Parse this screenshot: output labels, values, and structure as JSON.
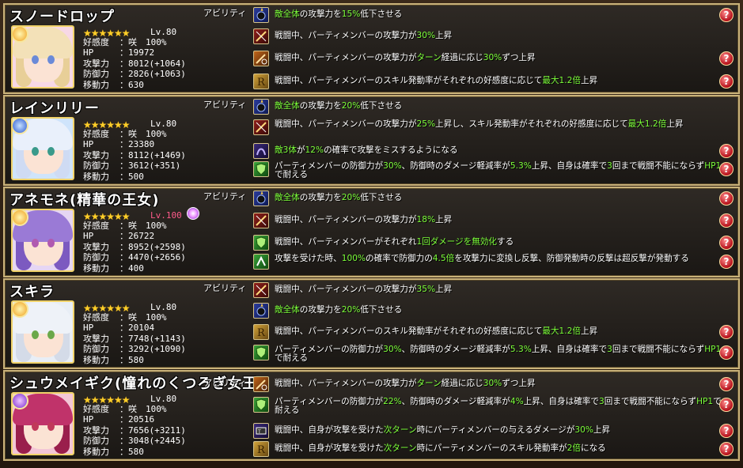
{
  "labels": {
    "ability_tag": "アビリティ",
    "level_prefix": "Lv.",
    "affection": "好感度",
    "hp": "HP",
    "attack": "攻撃力",
    "defense": "防御力",
    "movement": "移動力",
    "help": "?"
  },
  "colors": {
    "panel_border": "#c9b27a",
    "highlight_green": "#7dff3a",
    "help_red": "#b40f1a",
    "level_red": "#ff5a8a",
    "star_gold": "#ffcf2a"
  },
  "characters": [
    {
      "name": "スノードロップ",
      "level": "Lv.80",
      "stars": "★★★★★★",
      "affection": "：咲　100%",
      "hp": "：19972",
      "attack": "：8012(+1064)",
      "defense": "：2826(+1063)",
      "movement": "：630",
      "attribute_icon": "sun-attribute-icon",
      "abilities": [
        {
          "icon": "blast-icon",
          "text_parts": [
            {
              "t": "敵全体",
              "hl": true
            },
            {
              "t": "の攻撃力を"
            },
            {
              "t": "15%",
              "hl": true
            },
            {
              "t": "低下させる"
            }
          ]
        },
        {
          "icon": "sword-burst-icon",
          "text_parts": [
            {
              "t": "戦闘中、パーティメンバーの攻撃力が"
            },
            {
              "t": "30%",
              "hl": true
            },
            {
              "t": "上昇"
            }
          ]
        },
        {
          "icon": "turn-sword-icon",
          "text_parts": [
            {
              "t": "戦闘中、パーティメンバーの攻撃力が"
            },
            {
              "t": "ターン",
              "hl": true
            },
            {
              "t": "経過に応じ"
            },
            {
              "t": "30%",
              "hl": true
            },
            {
              "t": "ずつ上昇"
            }
          ]
        },
        {
          "icon": "skill-rate-icon",
          "text_parts": [
            {
              "t": "戦闘中、パーティメンバーのスキル発動率がそれぞれの好感度に応じて"
            },
            {
              "t": "最大1.2倍",
              "hl": true
            },
            {
              "t": "上昇"
            }
          ]
        }
      ]
    },
    {
      "name": "レインリリー",
      "level": "Lv.80",
      "stars": "★★★★★★",
      "affection": "：咲　100%",
      "hp": "：23380",
      "attack": "：8112(+1469)",
      "defense": "：3612(+351)",
      "movement": "：500",
      "attribute_icon": "blue-attribute-icon",
      "abilities": [
        {
          "icon": "blast-icon",
          "text_parts": [
            {
              "t": "敵全体",
              "hl": true
            },
            {
              "t": "の攻撃力を"
            },
            {
              "t": "20%",
              "hl": true
            },
            {
              "t": "低下させる"
            }
          ]
        },
        {
          "icon": "sword-burst-icon",
          "text_parts": [
            {
              "t": "戦闘中、パーティメンバーの攻撃力が"
            },
            {
              "t": "25%",
              "hl": true
            },
            {
              "t": "上昇し、スキル発動率がそれぞれの好感度に応じて"
            },
            {
              "t": "最大1.2倍",
              "hl": true
            },
            {
              "t": "上昇"
            }
          ]
        },
        {
          "icon": "miss-icon",
          "text_parts": [
            {
              "t": "敵3体",
              "hl": true
            },
            {
              "t": "が"
            },
            {
              "t": "12%",
              "hl": true
            },
            {
              "t": "の確率で攻撃をミスするようになる"
            }
          ]
        },
        {
          "icon": "shield-icon",
          "text_parts": [
            {
              "t": "パーティメンバーの防御力が"
            },
            {
              "t": "30%",
              "hl": true
            },
            {
              "t": "、防御時のダメージ軽減率が"
            },
            {
              "t": "5.3%",
              "hl": true
            },
            {
              "t": "上昇、自身は確率で"
            },
            {
              "t": "3",
              "hl": true
            },
            {
              "t": "回まで戦闘不能にならず"
            },
            {
              "t": "HP1",
              "hl": true
            },
            {
              "t": "で耐える"
            }
          ]
        }
      ]
    },
    {
      "name": "アネモネ(精華の王女)",
      "level": "Lv.100",
      "stars": "★★★★★★",
      "affection": "：咲　100%",
      "hp": "：26722",
      "attack": "：8952(+2598)",
      "defense": "：4470(+2656)",
      "movement": "：400",
      "attribute_icon": "sun-attribute-icon",
      "abilities": [
        {
          "icon": "blast-icon",
          "text_parts": [
            {
              "t": "敵全体",
              "hl": true
            },
            {
              "t": "の攻撃力を"
            },
            {
              "t": "20%",
              "hl": true
            },
            {
              "t": "低下させる"
            }
          ]
        },
        {
          "icon": "sword-burst-icon",
          "text_parts": [
            {
              "t": "戦闘中、パーティメンバーの攻撃力が"
            },
            {
              "t": "18%",
              "hl": true
            },
            {
              "t": "上昇"
            }
          ]
        },
        {
          "icon": "shield-icon",
          "text_parts": [
            {
              "t": "戦闘中、パーティメンバーがそれぞれ"
            },
            {
              "t": "1回ダメージを無効化",
              "hl": true
            },
            {
              "t": "する"
            }
          ]
        },
        {
          "icon": "counter-icon",
          "text_parts": [
            {
              "t": "攻撃を受けた時、"
            },
            {
              "t": "100%",
              "hl": true
            },
            {
              "t": "の確率で防御力の"
            },
            {
              "t": "4.5倍",
              "hl": true
            },
            {
              "t": "を攻撃力に変換し反撃、防御発動時の反撃は超反撃が発動する"
            }
          ]
        }
      ]
    },
    {
      "name": "スキラ",
      "level": "Lv.80",
      "stars": "★★★★★★",
      "affection": "：咲　100%",
      "hp": "：20104",
      "attack": "：7748(+1143)",
      "defense": "：3292(+1090)",
      "movement": "：580",
      "attribute_icon": "sun-attribute-icon",
      "abilities": [
        {
          "icon": "sword-burst-icon",
          "text_parts": [
            {
              "t": "戦闘中、パーティメンバーの攻撃力が"
            },
            {
              "t": "35%",
              "hl": true
            },
            {
              "t": "上昇"
            }
          ]
        },
        {
          "icon": "blast-icon",
          "text_parts": [
            {
              "t": "敵全体",
              "hl": true
            },
            {
              "t": "の攻撃力を"
            },
            {
              "t": "20%",
              "hl": true
            },
            {
              "t": "低下させる"
            }
          ]
        },
        {
          "icon": "skill-rate-icon",
          "text_parts": [
            {
              "t": "戦闘中、パーティメンバーのスキル発動率がそれぞれの好感度に応じて"
            },
            {
              "t": "最大1.2倍",
              "hl": true
            },
            {
              "t": "上昇"
            }
          ]
        },
        {
          "icon": "shield-icon",
          "text_parts": [
            {
              "t": "パーティメンバーの防御力が"
            },
            {
              "t": "30%",
              "hl": true
            },
            {
              "t": "、防御時のダメージ軽減率が"
            },
            {
              "t": "5.3%",
              "hl": true
            },
            {
              "t": "上昇、自身は確率で"
            },
            {
              "t": "3",
              "hl": true
            },
            {
              "t": "回まで戦闘不能にならず"
            },
            {
              "t": "HP1",
              "hl": true
            },
            {
              "t": "で耐える"
            }
          ]
        }
      ]
    },
    {
      "name": "シュウメイギク(憧れのくつろぎ女王)",
      "level": "Lv.80",
      "stars": "★★★★★★",
      "affection": "：咲　100%",
      "hp": "：20516",
      "attack": "：7656(+3211)",
      "defense": "：3048(+2445)",
      "movement": "：580",
      "attribute_icon": "purple-attribute-icon",
      "abilities": [
        {
          "icon": "turn-sword-icon",
          "text_parts": [
            {
              "t": "戦闘中、パーティメンバーの攻撃力が"
            },
            {
              "t": "ターン",
              "hl": true
            },
            {
              "t": "経過に応じ"
            },
            {
              "t": "30%",
              "hl": true
            },
            {
              "t": "ずつ上昇"
            }
          ]
        },
        {
          "icon": "shield-icon",
          "text_parts": [
            {
              "t": "パーティメンバーの防御力が"
            },
            {
              "t": "22%",
              "hl": true
            },
            {
              "t": "、防御時のダメージ軽減率が"
            },
            {
              "t": "4%",
              "hl": true
            },
            {
              "t": "上昇、自身は確率で"
            },
            {
              "t": "3",
              "hl": true
            },
            {
              "t": "回まで戦闘不能にならず"
            },
            {
              "t": "HP1",
              "hl": true
            },
            {
              "t": "で耐える"
            }
          ]
        },
        {
          "icon": "next-turn-damage-icon",
          "text_parts": [
            {
              "t": "戦闘中、自身が攻撃を受けた"
            },
            {
              "t": "次ターン",
              "hl": true
            },
            {
              "t": "時にパーティメンバーの与えるダメージが"
            },
            {
              "t": "30%",
              "hl": true
            },
            {
              "t": "上昇"
            }
          ]
        },
        {
          "icon": "skill-rate-icon",
          "text_parts": [
            {
              "t": "戦闘中、自身が攻撃を受けた"
            },
            {
              "t": "次ターン",
              "hl": true
            },
            {
              "t": "時にパーティメンバーのスキル発動率が"
            },
            {
              "t": "2倍",
              "hl": true
            },
            {
              "t": "になる"
            }
          ]
        }
      ]
    }
  ]
}
